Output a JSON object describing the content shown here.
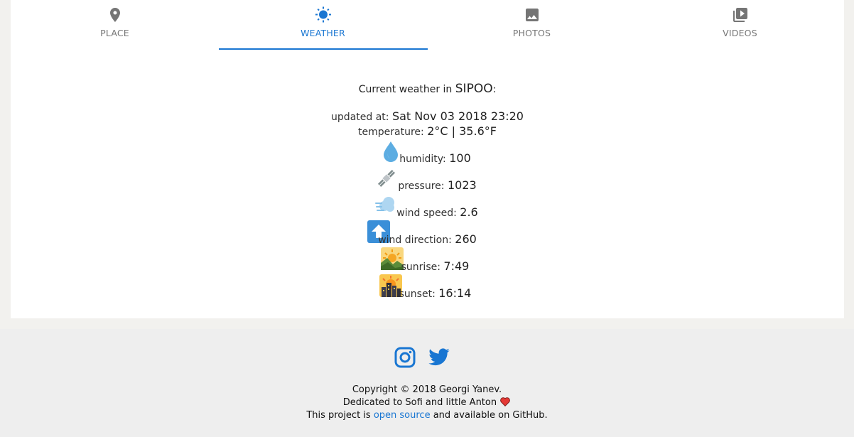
{
  "tabs": [
    {
      "label": "PLACE",
      "icon": "map-pin-icon"
    },
    {
      "label": "WEATHER",
      "icon": "sun-icon",
      "active": true
    },
    {
      "label": "PHOTOS",
      "icon": "image-icon"
    },
    {
      "label": "VIDEOS",
      "icon": "video-library-icon"
    }
  ],
  "weather": {
    "heading_prefix": "Current weather in ",
    "city": "SIPOO",
    "heading_suffix": ":",
    "updated_label": "updated at: ",
    "updated_value": "Sat Nov 03 2018 23:20",
    "temperature_label": "temperature: ",
    "temperature_value": "2°C | 35.6°F",
    "humidity_label": "humidity: ",
    "humidity_value": "100",
    "pressure_label": "pressure: ",
    "pressure_value": "1023",
    "wind_speed_label": "wind speed: ",
    "wind_speed_value": "2.6",
    "wind_direction_label": "wind direction: ",
    "wind_direction_value": "260",
    "sunrise_label": "sunrise: ",
    "sunrise_value": "7:49",
    "sunset_label": "sunset: ",
    "sunset_value": "16:14"
  },
  "footer": {
    "social": [
      "instagram-icon",
      "twitter-icon"
    ],
    "copyright": "Copyright © 2018 Georgi Yanev.",
    "dedication": "Dedicated to Sofi and little Anton",
    "project_prefix": "This project is ",
    "project_link": "open source",
    "project_suffix": " and available on GitHub."
  },
  "colors": {
    "accent": "#1976d2",
    "tab_inactive": "#757575",
    "background": "#f2f1ee",
    "footer_bg": "#eeeeee",
    "heart": "#e53935"
  }
}
